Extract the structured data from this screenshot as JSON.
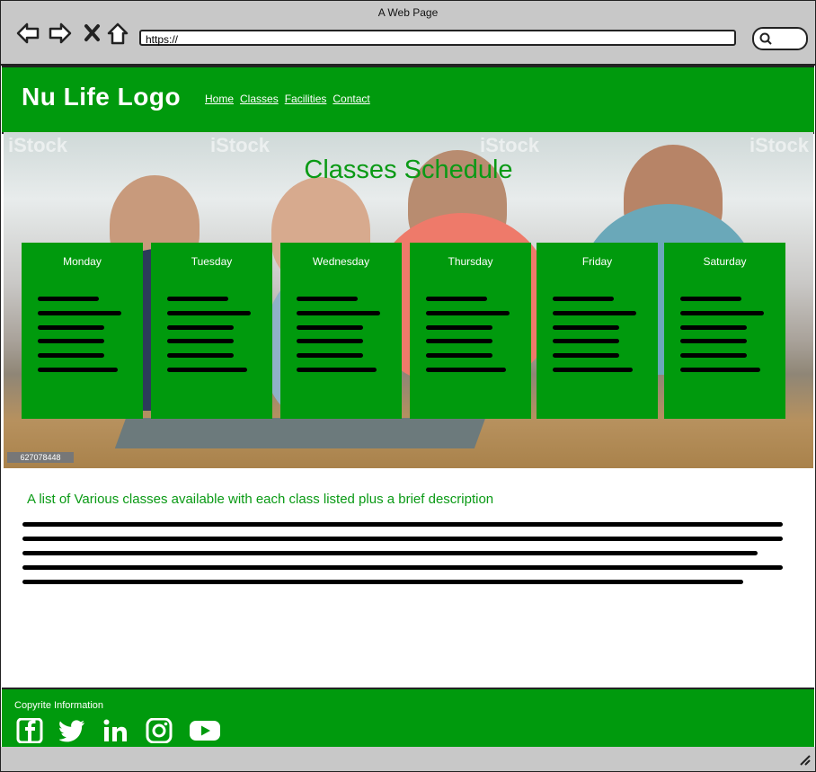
{
  "browser": {
    "window_title": "A Web Page",
    "url": "https://"
  },
  "header": {
    "logo_text": "Nu Life Logo",
    "nav": [
      "Home",
      "Classes",
      "Facilities",
      "Contact"
    ]
  },
  "hero": {
    "title": "Classes Schedule",
    "stock_id": "627078448",
    "watermark": "iStock",
    "days": [
      "Monday",
      "Tuesday",
      "Wednesday",
      "Thursday",
      "Friday",
      "Saturday"
    ]
  },
  "content": {
    "subheading": "A list of Various classes available with each class listed plus a brief description"
  },
  "footer": {
    "copyright": "Copyrite Information",
    "social_icons": [
      "facebook-icon",
      "twitter-icon",
      "linkedin-icon",
      "instagram-icon",
      "youtube-icon"
    ]
  },
  "colors": {
    "brand_green": "#009a0d",
    "title_green": "#0a9a15",
    "chrome_gray": "#c8c8c8"
  }
}
